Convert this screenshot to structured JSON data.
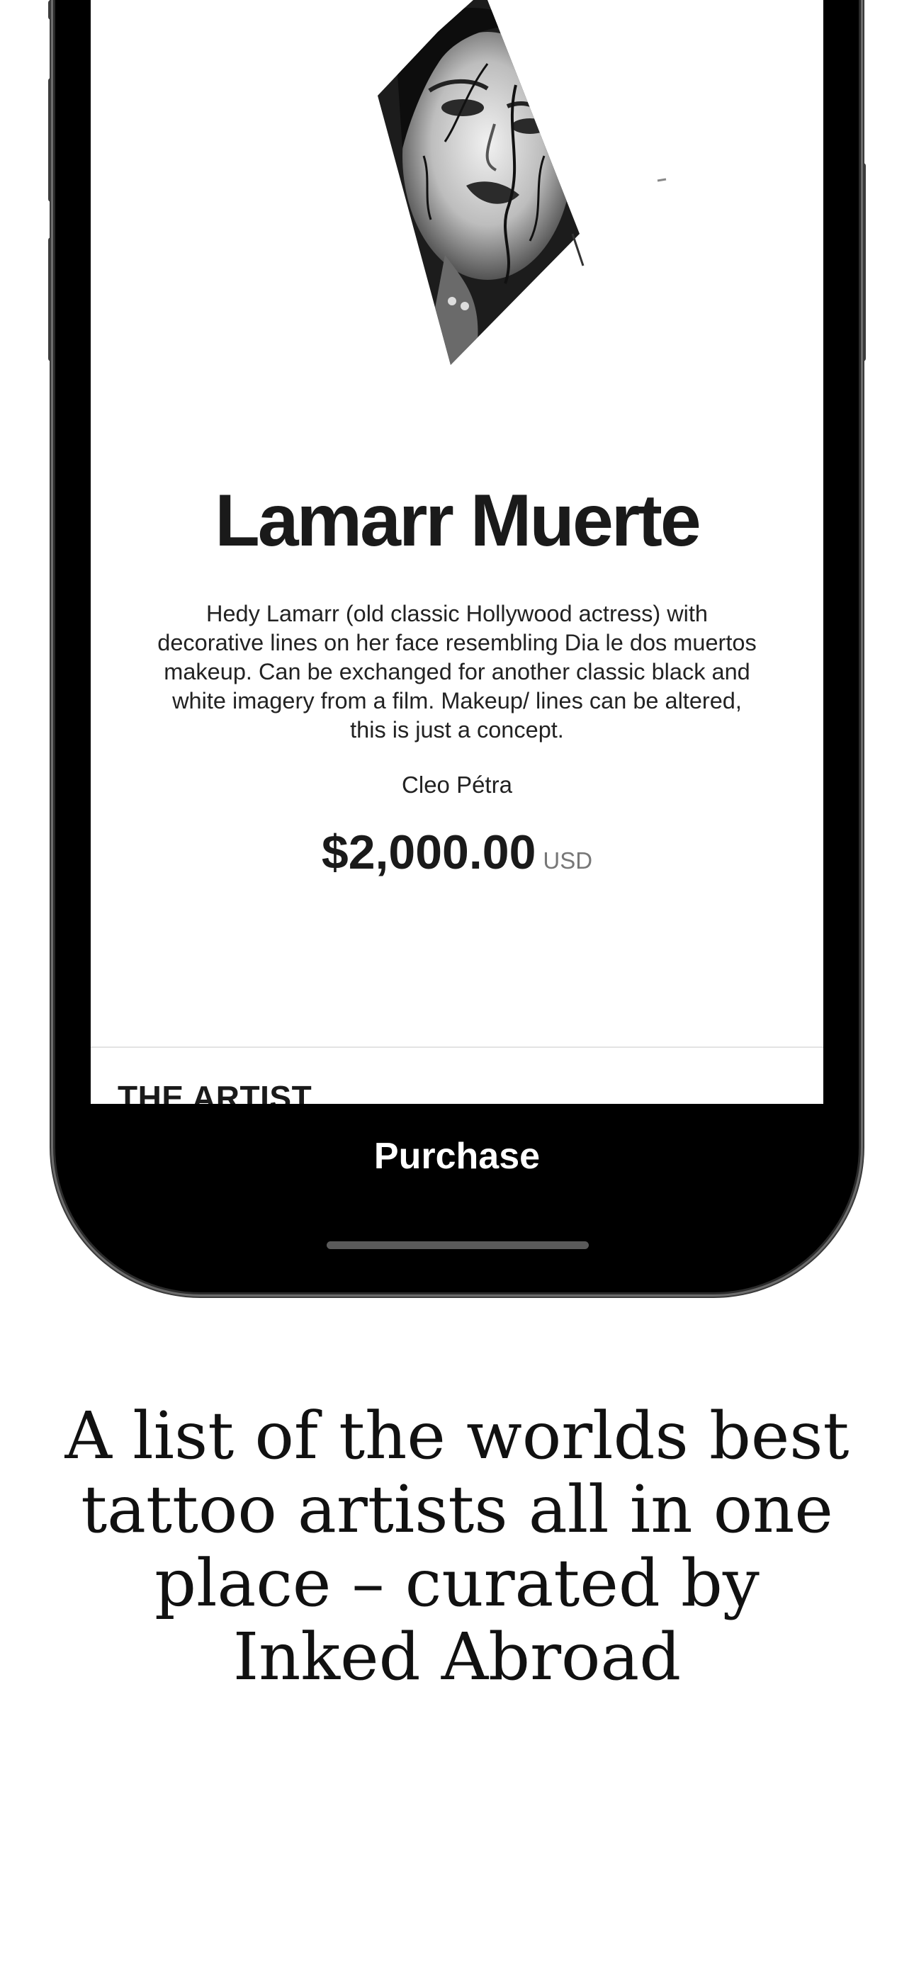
{
  "product": {
    "title": "Lamarr Muerte",
    "description": "Hedy Lamarr (old classic Hollywood actress) with decorative lines on her face resembling Dia le dos muertos makeup. Can be exchanged for another classic black and white imagery from a film. Makeup/ lines can be altered, this is just a concept.",
    "artist": "Cleo Pétra",
    "price": "$2,000.00",
    "currency": "USD"
  },
  "section": {
    "heading": "THE ARTIST"
  },
  "actions": {
    "purchase_label": "Purchase"
  },
  "caption": {
    "text": "A list of the worlds best tattoo artists all in one place – curated by Inked Abroad"
  }
}
